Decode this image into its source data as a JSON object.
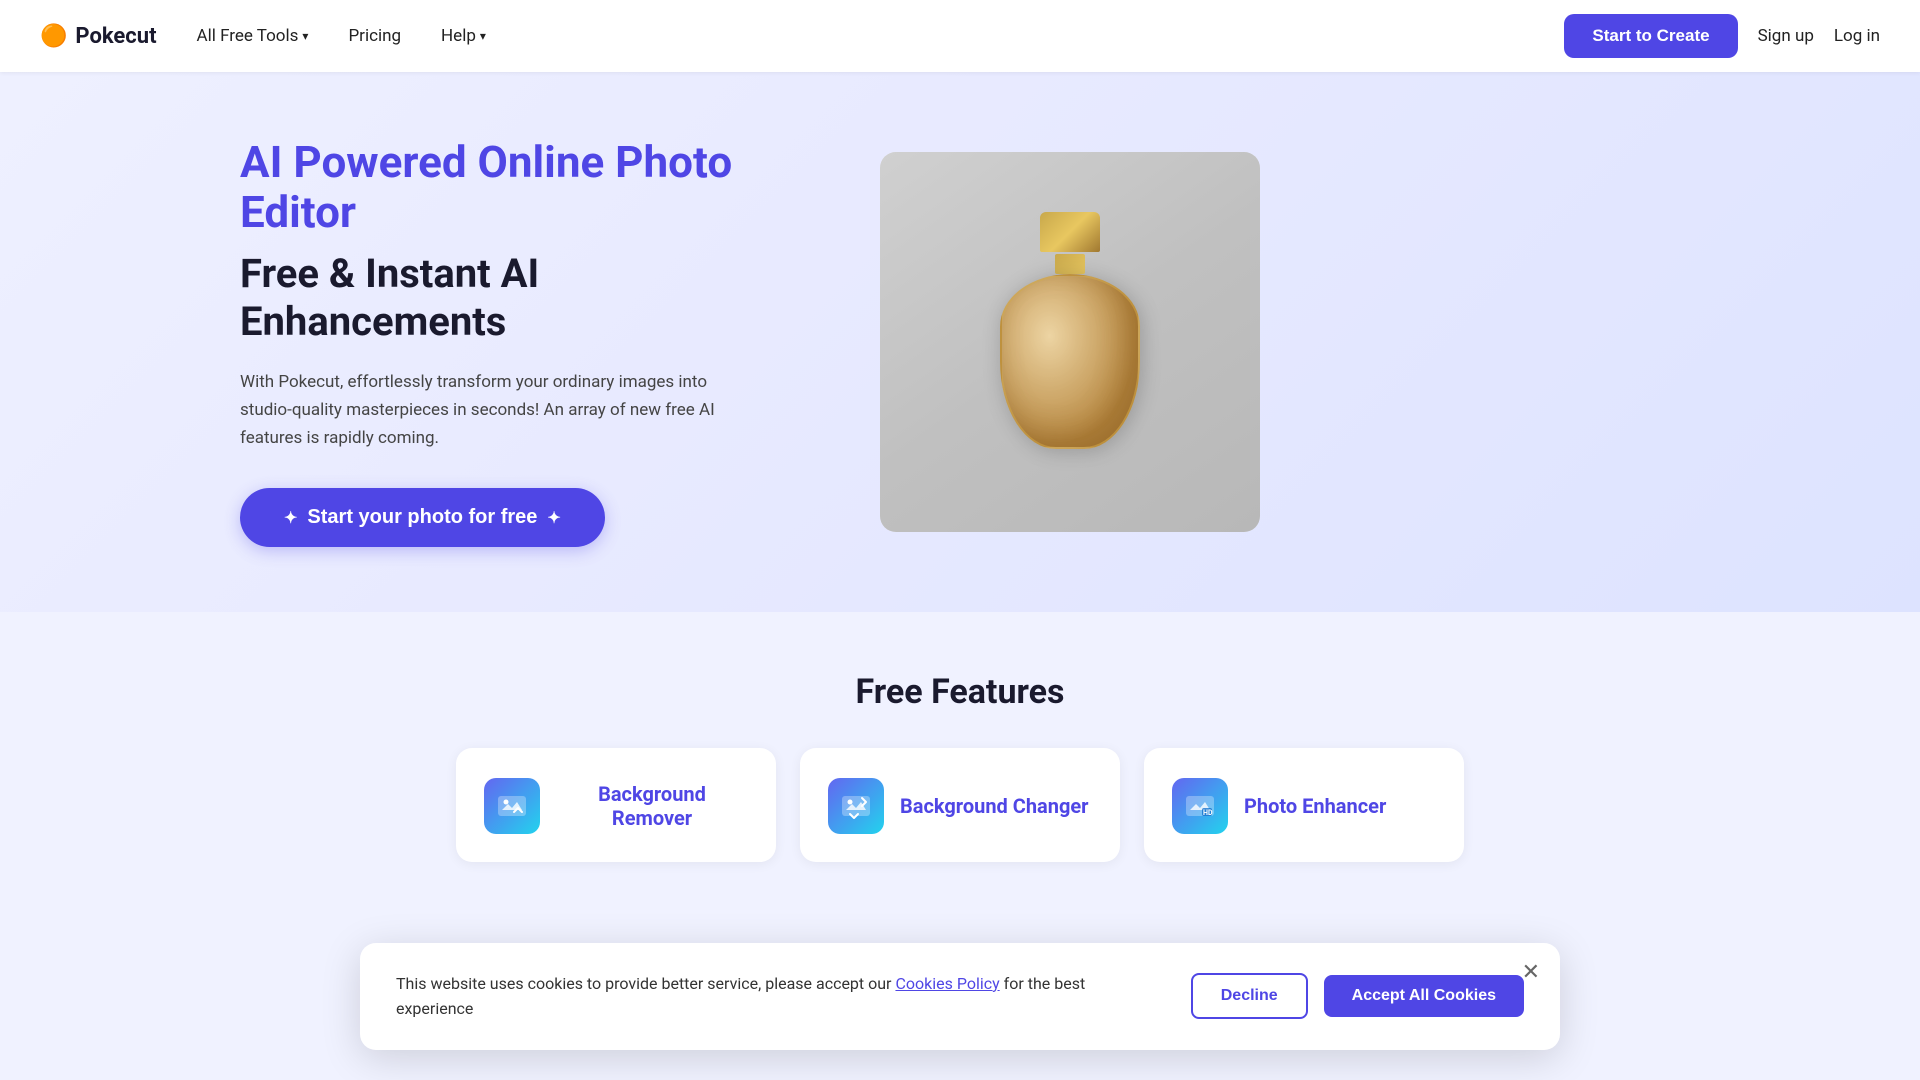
{
  "brand": {
    "name": "Pokecut",
    "logo_emoji": "🟠"
  },
  "nav": {
    "all_free_tools_label": "All Free Tools",
    "pricing_label": "Pricing",
    "help_label": "Help",
    "start_to_create_label": "Start to Create",
    "sign_up_label": "Sign up",
    "log_in_label": "Log in"
  },
  "hero": {
    "title_colored": "AI Powered Online Photo Editor",
    "title_black": "Free & Instant AI Enhancements",
    "description": "With Pokecut, effortlessly transform your ordinary images into studio-quality masterpieces in seconds! An array of new free AI features is rapidly coming.",
    "cta_label": "Start your photo for free",
    "cta_sparkle_left": "✦",
    "cta_sparkle_right": "✦"
  },
  "features": {
    "section_title": "Free Features",
    "cards": [
      {
        "label": "Background Remover",
        "icon": "🖼️"
      },
      {
        "label": "Background Changer",
        "icon": "🖼️"
      },
      {
        "label": "Photo Enhancer",
        "icon": "🖼️"
      }
    ]
  },
  "cookie_banner": {
    "message_pre": "This website uses cookies to provide better service, please accept our",
    "policy_link_text": "Cookies Policy",
    "message_post": "for the best experience",
    "decline_label": "Decline",
    "accept_label": "Accept All Cookies"
  }
}
